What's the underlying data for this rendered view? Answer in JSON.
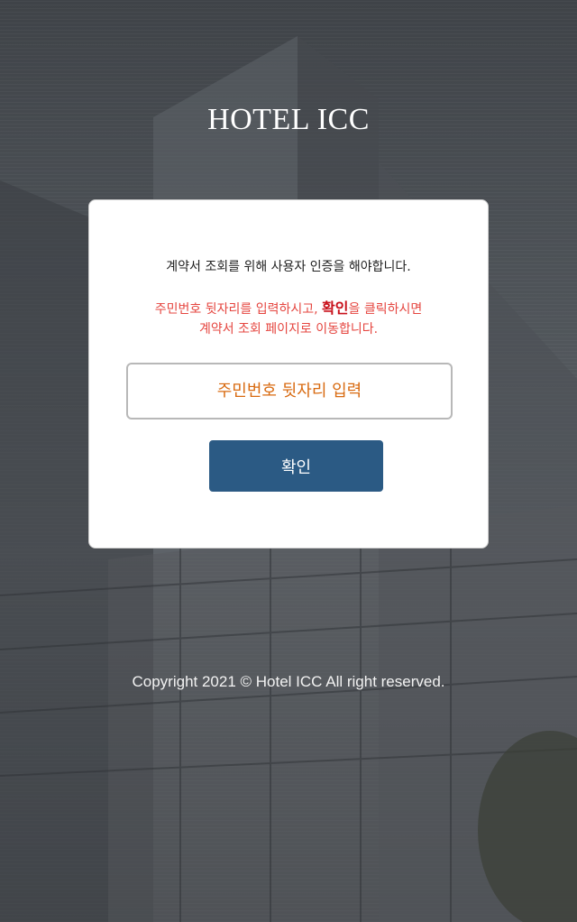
{
  "header": {
    "title": "HOTEL ICC"
  },
  "login_card": {
    "intro_text": "계약서 조회를 위해 사용자 인증을 해야합니다.",
    "instruction_part1": "주민번호 뒷자리를 입력하시고, ",
    "instruction_emphasis": "확인",
    "instruction_part2": "을 클릭하시면",
    "instruction_line2": "계약서 조회 페이지로 이동합니다.",
    "id_input_placeholder": "주민번호 뒷자리 입력",
    "confirm_button_label": "확인"
  },
  "footer": {
    "copyright": "Copyright 2021 © Hotel ICC All right reserved."
  },
  "colors": {
    "button_bg": "#2b5a84",
    "instruction_text": "#e5453f",
    "placeholder_text": "#d86a10"
  }
}
